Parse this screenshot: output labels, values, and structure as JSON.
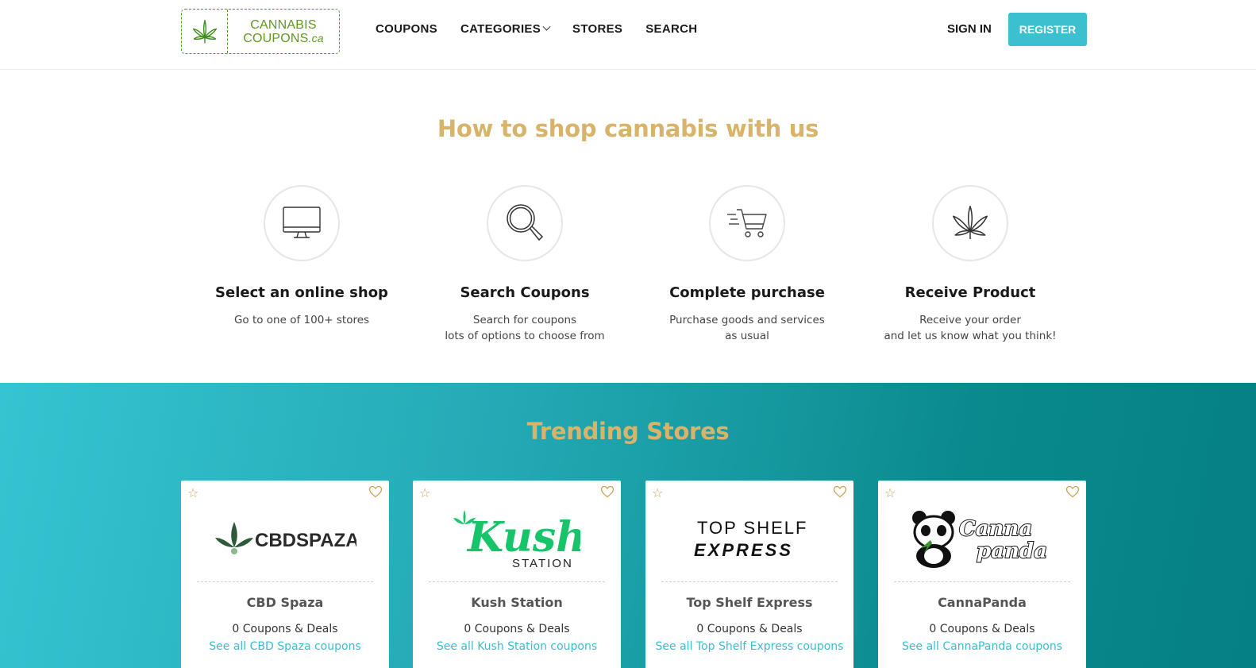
{
  "brand": {
    "line1": "CANNABIS",
    "line2": "COUPONS",
    "tld": ".ca",
    "color": "#5d9a1e"
  },
  "nav": {
    "items": [
      {
        "label": "COUPONS"
      },
      {
        "label": "CATEGORIES",
        "dropdown": true
      },
      {
        "label": "STORES"
      },
      {
        "label": "SEARCH"
      }
    ]
  },
  "auth": {
    "signin": "SIGN IN",
    "register": "REGISTER",
    "register_color": "#3bc0d0"
  },
  "howto": {
    "title": "How to shop cannabis with us",
    "steps": [
      {
        "icon": "monitor-icon",
        "title": "Select an online shop",
        "text": "Go to one of 100+ stores"
      },
      {
        "icon": "magnifier-icon",
        "title": "Search Coupons",
        "text": "Search for coupons\nlots of options to choose from"
      },
      {
        "icon": "shopping-cart-icon",
        "title": "Complete purchase",
        "text": "Purchase goods and services\nas usual"
      },
      {
        "icon": "cannabis-leaf-icon",
        "title": "Receive Product",
        "text": "Receive your order\nand let us know what you think!"
      }
    ]
  },
  "trending": {
    "title": "Trending Stores",
    "accent": "#d8b46a",
    "stores": [
      {
        "name": "CBD Spaza",
        "count": "0 Coupons & Deals",
        "link": "See all CBD Spaza coupons",
        "logo_text": "CBDSPAZA"
      },
      {
        "name": "Kush Station",
        "count": "0 Coupons & Deals",
        "link": "See all Kush Station coupons",
        "logo_text": "Kush",
        "logo_sub": "STATION"
      },
      {
        "name": "Top Shelf Express",
        "count": "0 Coupons & Deals",
        "link": "See all Top Shelf Express coupons",
        "logo_text": "TOP SHELF",
        "logo_sub": "EXPRESS"
      },
      {
        "name": "CannaPanda",
        "count": "0 Coupons & Deals",
        "link": "See all CannaPanda coupons",
        "logo_text": "Canna",
        "logo_sub": "panda"
      }
    ]
  }
}
